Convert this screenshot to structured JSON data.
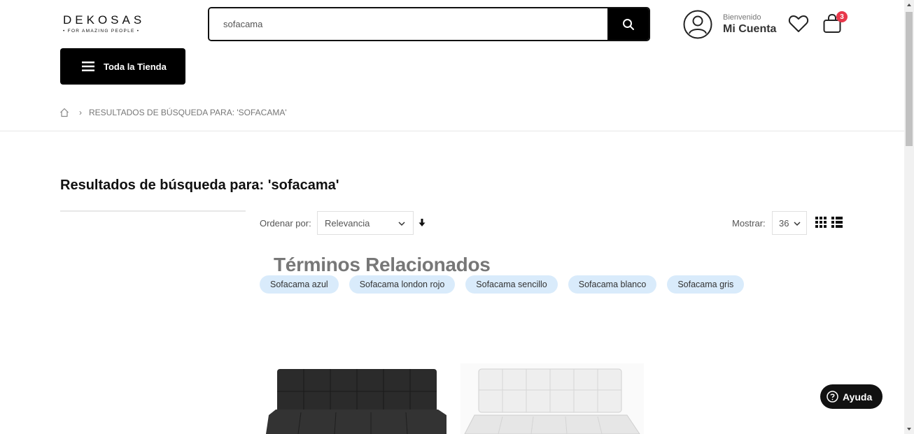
{
  "brand": {
    "name": "DEKOSAS",
    "tagline": "• FOR AMAZING PEOPLE •"
  },
  "search": {
    "value": "sofacama",
    "icon": "search-icon"
  },
  "account": {
    "greeting": "Bienvenido",
    "label": "Mi Cuenta",
    "icon": "user-icon"
  },
  "wishlist": {
    "icon": "heart-icon"
  },
  "cart": {
    "count": "3",
    "icon": "shopping-bag-icon",
    "badge_color": "#e8374a"
  },
  "store_menu": {
    "label": "Toda la Tienda",
    "icon": "hamburger-icon"
  },
  "breadcrumb": {
    "home_icon": "home-icon",
    "current": "RESULTADOS DE BÚSQUEDA PARA: 'SOFACAMA'"
  },
  "page": {
    "title": "Resultados de búsqueda para: 'sofacama'"
  },
  "toolbar": {
    "sort_label": "Ordenar por:",
    "sort_value": "Relevancia",
    "sort_direction_icon": "arrow-down-icon",
    "show_label": "Mostrar:",
    "show_value": "36",
    "views": [
      "grid-view-icon",
      "list-view-icon"
    ]
  },
  "related": {
    "title": "Términos Relacionados",
    "tags": [
      "Sofacama azul",
      "Sofacama london rojo",
      "Sofacama sencillo",
      "Sofacama blanco",
      "Sofacama gris"
    ],
    "tag_color": "#d9ebfb"
  },
  "products": [
    {
      "image": "black-sofa-bed-image",
      "color": "#2b2b2b"
    },
    {
      "image": "white-sofa-bed-image",
      "color": "#f0f0f0"
    }
  ],
  "help": {
    "label": "Ayuda",
    "icon": "help-icon"
  },
  "colors": {
    "accent": "#000000",
    "text": "#222222"
  }
}
